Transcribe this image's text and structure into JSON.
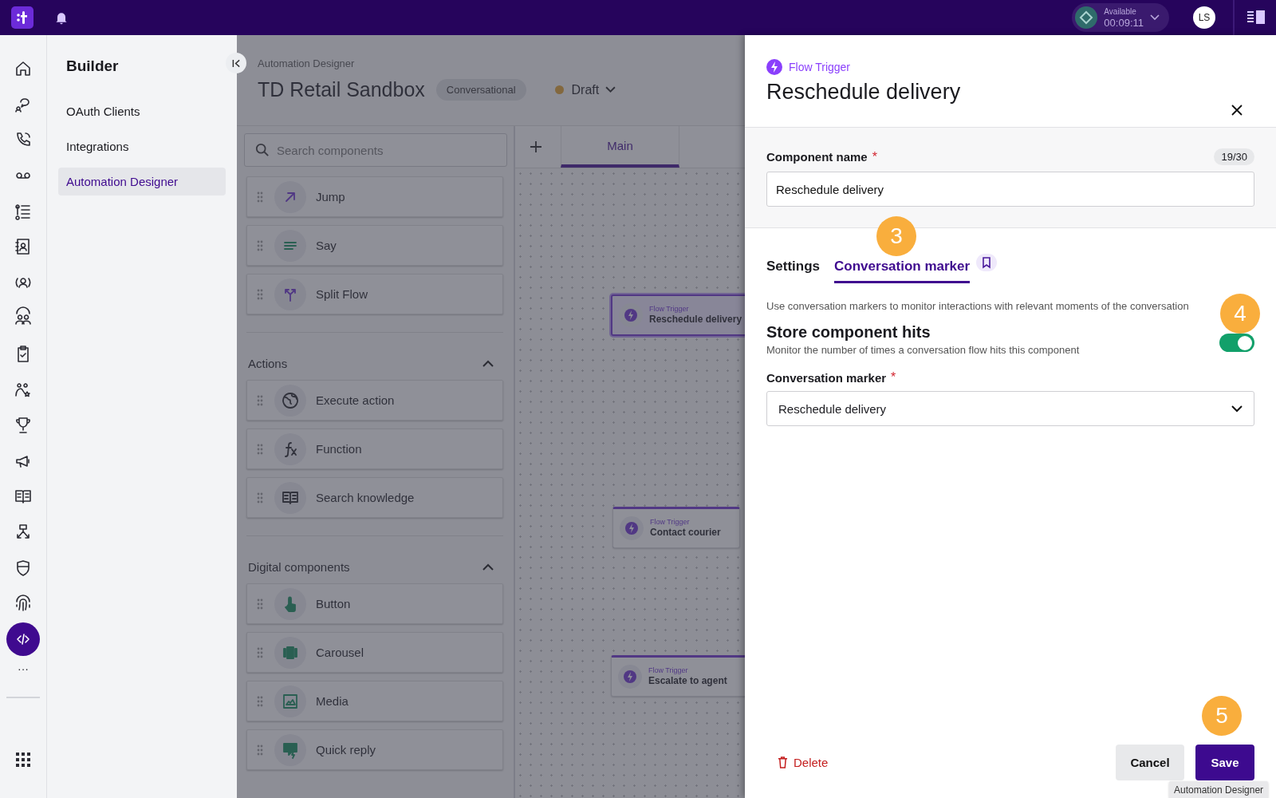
{
  "top_bar": {
    "status": {
      "label": "Available",
      "timer": "00:09:11"
    },
    "avatar": "LS"
  },
  "nav_rail": {
    "items": [
      {
        "kind": "home",
        "selected": false
      },
      {
        "kind": "chat",
        "selected": false
      },
      {
        "kind": "phone",
        "selected": false
      },
      {
        "kind": "voicemail",
        "selected": false
      },
      {
        "kind": "list",
        "selected": false
      },
      {
        "kind": "contacts",
        "selected": false
      },
      {
        "kind": "user",
        "selected": false
      },
      {
        "kind": "team",
        "selected": false
      },
      {
        "kind": "clipboard",
        "selected": false
      },
      {
        "kind": "people",
        "selected": false
      },
      {
        "kind": "trophy",
        "selected": false
      },
      {
        "kind": "megaphone",
        "selected": false
      },
      {
        "kind": "book",
        "selected": false
      },
      {
        "kind": "flow",
        "selected": false
      },
      {
        "kind": "shield",
        "selected": false
      },
      {
        "kind": "fingerprint",
        "selected": false
      },
      {
        "kind": "code",
        "selected": true
      }
    ],
    "more": "···"
  },
  "sidebar": {
    "title": "Builder",
    "items": [
      {
        "label": "OAuth Clients",
        "selected": false
      },
      {
        "label": "Integrations",
        "selected": false
      },
      {
        "label": "Automation Designer",
        "selected": true
      }
    ]
  },
  "header": {
    "breadcrumb": "Automation Designer",
    "title": "TD Retail Sandbox",
    "chip": "Conversational",
    "status": "Draft"
  },
  "components": {
    "search": {
      "placeholder": "Search components"
    },
    "items": [
      {
        "kind": "jump",
        "label": "Jump"
      },
      {
        "kind": "say",
        "label": "Say"
      },
      {
        "kind": "split",
        "label": "Split Flow"
      }
    ],
    "sections": [
      {
        "title": "Actions",
        "expanded": true,
        "items": [
          {
            "kind": "globe",
            "label": "Execute action"
          },
          {
            "kind": "function",
            "label": "Function"
          },
          {
            "kind": "book",
            "label": "Search knowledge"
          }
        ]
      },
      {
        "title": "Digital components",
        "expanded": true,
        "items": [
          {
            "kind": "touch",
            "label": "Button"
          },
          {
            "kind": "carousel",
            "label": "Carousel"
          },
          {
            "kind": "media",
            "label": "Media"
          },
          {
            "kind": "reply",
            "label": "Quick reply"
          }
        ]
      }
    ]
  },
  "canvas": {
    "tabs": [
      {
        "label": "Main",
        "selected": true
      }
    ],
    "nodes": [
      {
        "type": "Flow Trigger",
        "name": "Reschedule delivery",
        "selected": true
      },
      {
        "type": "Flow Trigger",
        "name": "Contact courier",
        "selected": false
      },
      {
        "type": "Flow Trigger",
        "name": "Escalate to agent",
        "selected": false
      }
    ]
  },
  "panel": {
    "type": "Flow Trigger",
    "title": "Reschedule delivery",
    "name_field": {
      "label": "Component name",
      "required_mark": "*",
      "counter": "19/30",
      "value": "Reschedule delivery"
    },
    "tabs": [
      {
        "label": "Settings",
        "selected": false
      },
      {
        "label": "Conversation marker",
        "selected": true
      }
    ],
    "description": "Use conversation markers to monitor interactions with relevant moments of the conversation",
    "store_hits": {
      "title": "Store component hits",
      "subtitle": "Monitor the number of times a conversation flow hits this component",
      "on": true
    },
    "marker_field": {
      "label": "Conversation marker",
      "required_mark": "*",
      "value": "Reschedule delivery"
    },
    "delete": "Delete",
    "cancel": "Cancel",
    "save": "Save"
  },
  "annotations": [
    "3",
    "4",
    "5"
  ],
  "tooltip": "Automation Designer"
}
